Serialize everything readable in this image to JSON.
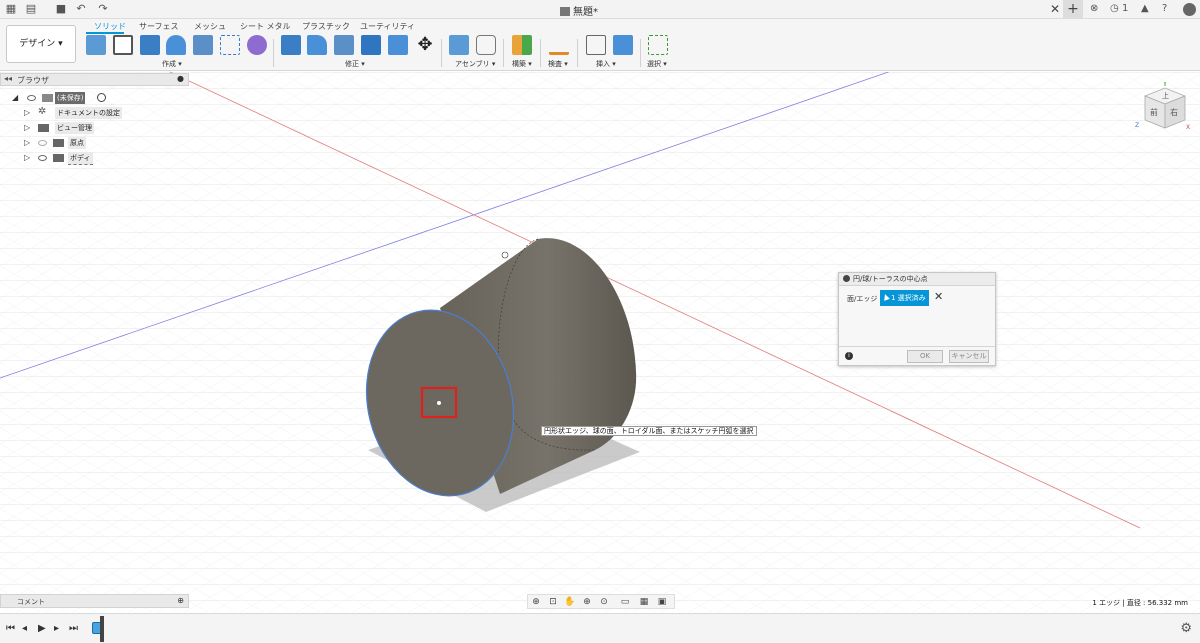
{
  "title_bar": {
    "document_title": "無題*",
    "notification_count": "1",
    "icons": [
      "apps-grid-icon",
      "file-menu-icon",
      "save-icon",
      "undo-icon",
      "redo-icon",
      "close-tab-icon",
      "new-tab-icon",
      "extensions-icon",
      "job-status-icon",
      "notification-icon",
      "help-icon",
      "user-avatar-icon"
    ]
  },
  "workspace_button": "デザイン ▾",
  "tabs": [
    {
      "label": "ソリッド",
      "active": true
    },
    {
      "label": "サーフェス",
      "active": false
    },
    {
      "label": "メッシュ",
      "active": false
    },
    {
      "label": "シート メタル",
      "active": false
    },
    {
      "label": "プラスチック",
      "active": false
    },
    {
      "label": "ユーティリティ",
      "active": false
    }
  ],
  "tool_groups": [
    {
      "label": "作成 ▾"
    },
    {
      "label": "修正 ▾"
    },
    {
      "label": "アセンブリ ▾"
    },
    {
      "label": "構築 ▾"
    },
    {
      "label": "検査 ▾"
    },
    {
      "label": "挿入 ▾"
    },
    {
      "label": "選択 ▾"
    }
  ],
  "browser": {
    "header": "ブラウザ",
    "items": [
      {
        "label": "(未保存)",
        "level": 0
      },
      {
        "label": "ドキュメントの設定",
        "level": 1
      },
      {
        "label": "ビュー管理",
        "level": 1
      },
      {
        "label": "原点",
        "level": 1
      },
      {
        "label": "ボディ",
        "level": 1
      }
    ]
  },
  "viewcube": {
    "face_front": "前",
    "face_right": "右",
    "face_top": "上",
    "axis_x": "X",
    "axis_y": "Y",
    "axis_z": "Z"
  },
  "dialog": {
    "title": "円/球/トーラスの中心点",
    "field_label": "面/エッジ",
    "selection_text": "1 選択済み",
    "ok_label": "OK",
    "cancel_label": "キャンセル"
  },
  "tooltip": "円形状エッジ、球の面、トロイダル面、またはスケッチ円弧を選択",
  "comments_header": "コメント",
  "status_text": "1 エッジ | 直径 : 56.332 mm",
  "colors": {
    "accent": "#0696d7",
    "body": "#6e6a62",
    "highlight_box": "#e0201a"
  }
}
